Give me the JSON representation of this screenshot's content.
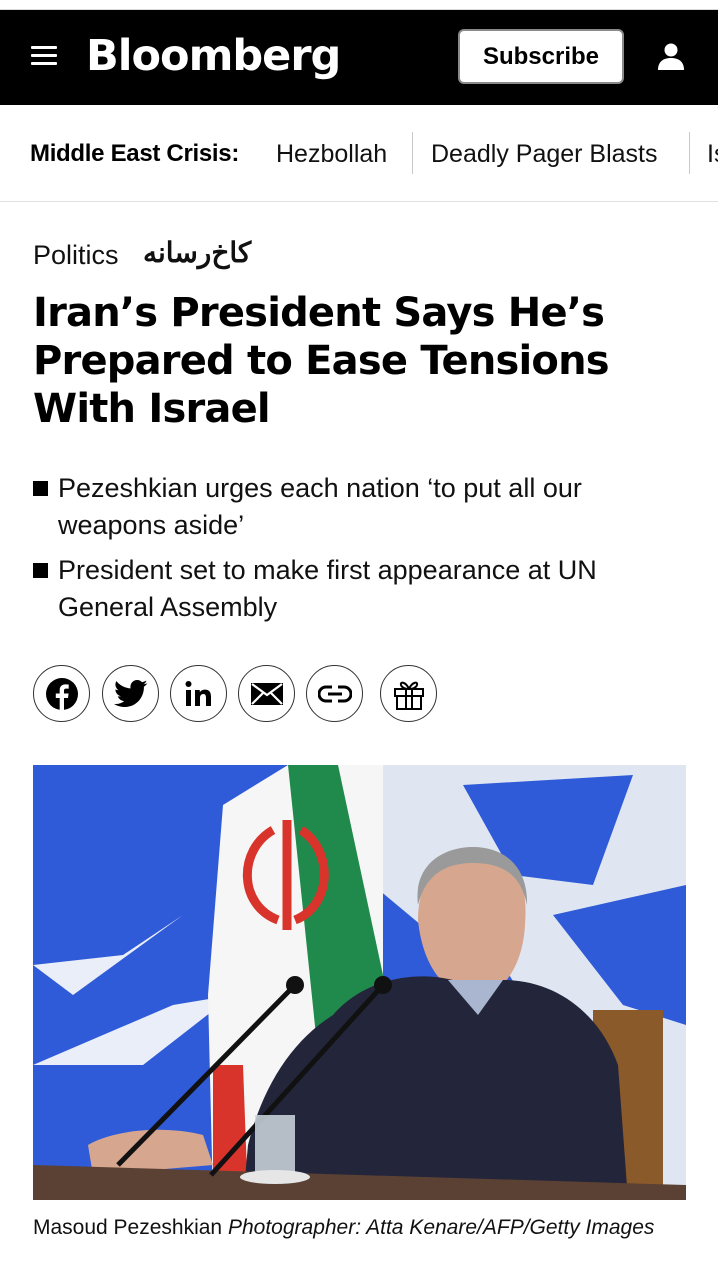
{
  "header": {
    "logo": "Bloomberg",
    "subscribe_label": "Subscribe"
  },
  "crisis_bar": {
    "label": "Middle East Crisis:",
    "links": [
      "Hezbollah",
      "Deadly Pager Blasts",
      "Is"
    ]
  },
  "article": {
    "kicker": "Politics",
    "watermark": "کاخ‌رسانه",
    "headline": "Iran’s President Says He’s Prepared to Ease Tensions With Israel",
    "bullets": [
      "Pezeshkian urges each nation ‘to put all our weapons aside’",
      "President set to make first appearance at UN General Assembly"
    ],
    "share_icons": [
      "facebook-icon",
      "twitter-icon",
      "linkedin-icon",
      "email-icon",
      "link-icon",
      "gift-icon"
    ],
    "photo": {
      "caption_name": "Masoud Pezeshkian",
      "caption_credit": "Photographer: Atta Kenare/AFP/Getty Images"
    }
  },
  "colors": {
    "header_bg": "#000000",
    "photo_backdrop": "#2f5bd8",
    "flag_green": "#1f8a4c",
    "flag_red": "#d9342b"
  }
}
